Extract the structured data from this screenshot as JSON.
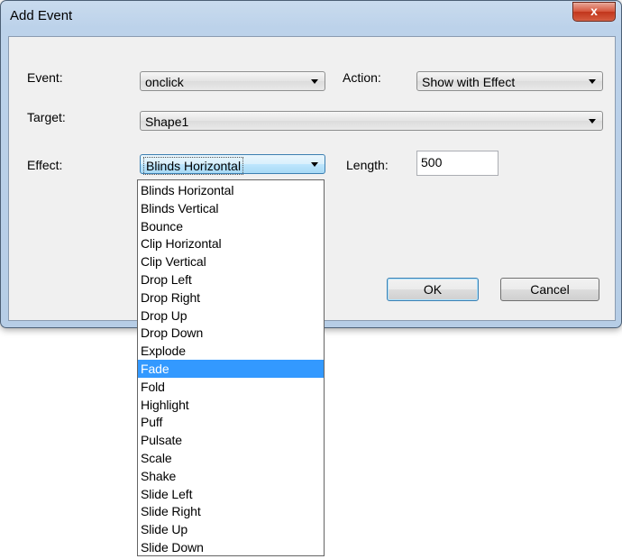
{
  "window": {
    "title": "Add Event",
    "close_label": "x"
  },
  "form": {
    "event_label": "Event:",
    "event_value": "onclick",
    "action_label": "Action:",
    "action_value": "Show with Effect",
    "target_label": "Target:",
    "target_value": "Shape1",
    "effect_label": "Effect:",
    "effect_value": "Blinds Horizontal",
    "length_label": "Length:",
    "length_value": "500"
  },
  "buttons": {
    "ok": "OK",
    "cancel": "Cancel"
  },
  "effect_options": {
    "selected_index": 10,
    "items": [
      "Blinds Horizontal",
      "Blinds Vertical",
      "Bounce",
      "Clip Horizontal",
      "Clip Vertical",
      "Drop Left",
      "Drop Right",
      "Drop Up",
      "Drop Down",
      "Explode",
      "Fade",
      "Fold",
      "Highlight",
      "Puff",
      "Pulsate",
      "Scale",
      "Shake",
      "Slide Left",
      "Slide Right",
      "Slide Up",
      "Slide Down"
    ]
  }
}
